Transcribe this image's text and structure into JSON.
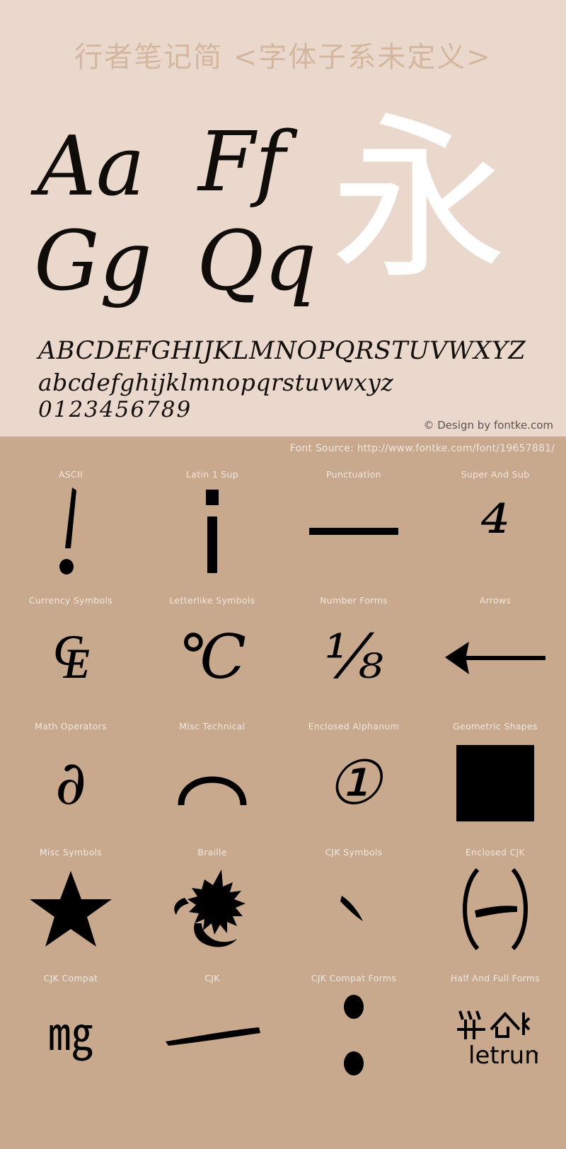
{
  "specimen": {
    "title": "行者笔记简 <字体子系未定义>",
    "hero_glyph": "永",
    "letter_pairs": [
      {
        "name": "Aa",
        "text": "Aa"
      },
      {
        "name": "Ff",
        "text": "Ff"
      },
      {
        "name": "Gg",
        "text": "Gg"
      },
      {
        "name": "Qq",
        "text": "Qq"
      }
    ],
    "alphabet_upper": "ABCDEFGHIJKLMNOPQRSTUVWXYZ",
    "alphabet_lower": "abcdefghijklmnopqrstuvwxyz",
    "digits": "0123456789",
    "copyright": "© Design by fontke.com",
    "background_color": "#ead8cd",
    "title_color": "#d3b79f",
    "hero_glyph_color": "#ffffff"
  },
  "glyph_grid": {
    "font_source": "Font Source: http://www.fontke.com/font/19657881/",
    "background_color": "#c8a98e",
    "label_color": "#f3e7de",
    "glyph_color": "#000000",
    "cells": [
      {
        "label": "ASCII",
        "glyph": "!",
        "icon": "exclamation-glyph"
      },
      {
        "label": "Latin 1 Sup",
        "glyph": "¡",
        "icon": "inverted-exclamation-glyph"
      },
      {
        "label": "Punctuation",
        "glyph": "—",
        "icon": "em-dash-glyph"
      },
      {
        "label": "Super And Sub",
        "glyph": "⁴",
        "icon": "superscript-four-glyph"
      },
      {
        "label": "Currency Symbols",
        "glyph": "₠",
        "icon": "euro-currency-sign-glyph"
      },
      {
        "label": "Letterlike Symbols",
        "glyph": "℃",
        "icon": "degree-celsius-glyph"
      },
      {
        "label": "Number Forms",
        "glyph": "⅛",
        "icon": "one-eighth-fraction-glyph"
      },
      {
        "label": "Arrows",
        "glyph": "←",
        "icon": "left-arrow-glyph"
      },
      {
        "label": "Math Operators",
        "glyph": "∂",
        "icon": "partial-differential-glyph"
      },
      {
        "label": "Misc Technical",
        "glyph": "⌒",
        "icon": "arc-glyph"
      },
      {
        "label": "Enclosed Alphanum",
        "glyph": "①",
        "icon": "circled-one-glyph"
      },
      {
        "label": "Geometric Shapes",
        "glyph": "■",
        "icon": "filled-square-glyph"
      },
      {
        "label": "Misc Symbols",
        "glyph": "★",
        "icon": "black-star-glyph"
      },
      {
        "label": "Braille",
        "glyph": "",
        "icon": "dragon-silhouette-glyph"
      },
      {
        "label": "CJK Symbols",
        "glyph": "、",
        "icon": "ideographic-comma-glyph"
      },
      {
        "label": "Enclosed CJK",
        "glyph": "㈠",
        "icon": "parenthesized-one-glyph"
      },
      {
        "label": "CJK Compat",
        "glyph": "㎎",
        "icon": "milligram-square-glyph"
      },
      {
        "label": "CJK",
        "glyph": "一",
        "icon": "cjk-one-glyph"
      },
      {
        "label": "CJK Compat Forms",
        "glyph": "︰",
        "icon": "vertical-two-dot-leader-glyph"
      },
      {
        "label": "Half And Full Forms",
        "glyph": "",
        "icon": "letrump-logo-glyph"
      }
    ]
  }
}
